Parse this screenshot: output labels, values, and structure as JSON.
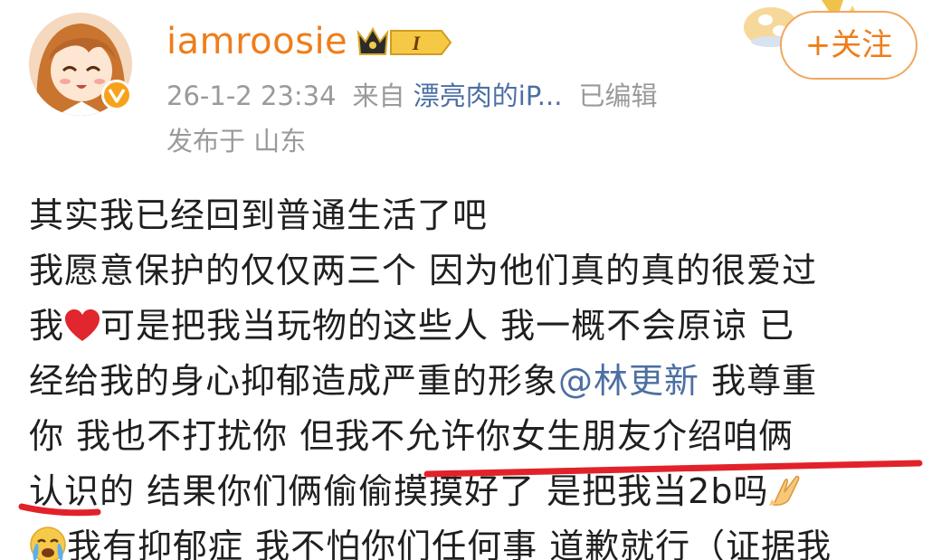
{
  "user": {
    "name": "iamroosie",
    "vip_level": "I"
  },
  "meta": {
    "timestamp": "26-1-2 23:34",
    "source_prefix": "来自",
    "source_device": "漂亮肉的iP...",
    "edited_label": "已编辑",
    "location": "发布于 山东"
  },
  "follow_button": {
    "label": "+关注"
  },
  "post": {
    "line1": "其实我已经回到普通生活了吧",
    "line2": "我愿意保护的仅仅两三个 因为他们真的真的很爱过",
    "line3_a": "我",
    "line3_b": "可是把我当玩物的这些人 我一概不会原谅 已",
    "line4_a": "经给我的身心抑郁造成严重的形象",
    "line4_mention": "@林更新",
    "line4_b": " 我尊重",
    "line5": "你 我也不打扰你 但我不允许你女生朋友介绍咱俩",
    "line6": "认识的 结果你们俩偷偷摸摸好了 是把我当2b吗",
    "line7_a": "我有抑郁症 我不怕你们任何事 道歉就行（证据我"
  },
  "icons": {
    "verified": "verified-v-icon",
    "vip": "crown-vip-icon",
    "heart": "red-heart-emoji",
    "pray": "pray-hands-emoji",
    "cry": "crying-face-emoji"
  },
  "colors": {
    "username": "#ef7d1a",
    "link": "#4c6fa3",
    "meta": "#9a9a9a",
    "scribble": "#e2222a"
  }
}
